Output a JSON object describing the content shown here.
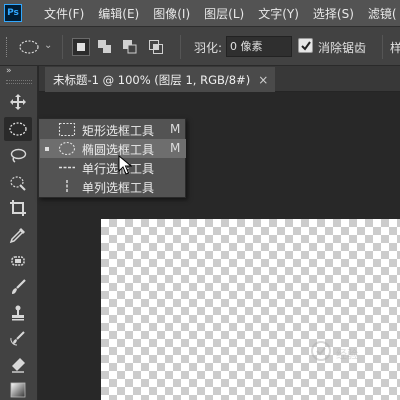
{
  "app": {
    "logo": "Ps"
  },
  "menu": [
    "文件(F)",
    "编辑(E)",
    "图像(I)",
    "图层(L)",
    "文字(Y)",
    "选择(S)",
    "滤镜("
  ],
  "options": {
    "feather_label": "羽化:",
    "feather_value": "0 像素",
    "antialias_label": "消除锯齿",
    "antialias_checked": true,
    "tail_label": "样"
  },
  "toolbar": {
    "collapse_label": "»",
    "tools": [
      "move-icon",
      "elliptical-marquee-icon",
      "lasso-icon",
      "quick-selection-icon",
      "crop-icon",
      "eyedropper-icon",
      "healing-brush-icon",
      "brush-icon",
      "clone-stamp-icon",
      "history-brush-icon",
      "eraser-icon",
      "gradient-icon"
    ],
    "active_tool": "elliptical-marquee-icon"
  },
  "document": {
    "tab_title": "未标题-1 @ 100% (图层 1, RGB/8#)",
    "close_glyph": "×"
  },
  "flyout": {
    "items": [
      {
        "label": "矩形选框工具",
        "shortcut": "M",
        "icon": "rect-marquee-icon",
        "selected": false
      },
      {
        "label": "椭圆选框工具",
        "shortcut": "M",
        "icon": "ellipse-marquee-icon",
        "selected": true
      },
      {
        "label": "单行选框工具",
        "shortcut": "",
        "icon": "single-row-marquee-icon",
        "selected": false
      },
      {
        "label": "单列选框工具",
        "shortcut": "",
        "icon": "single-column-marquee-icon",
        "selected": false
      }
    ]
  },
  "watermark": {
    "text": "经验"
  },
  "colors": {
    "accent": "#31a8ff",
    "menubar": "#535353",
    "panel": "#424242",
    "canvas_bg": "#282828"
  }
}
